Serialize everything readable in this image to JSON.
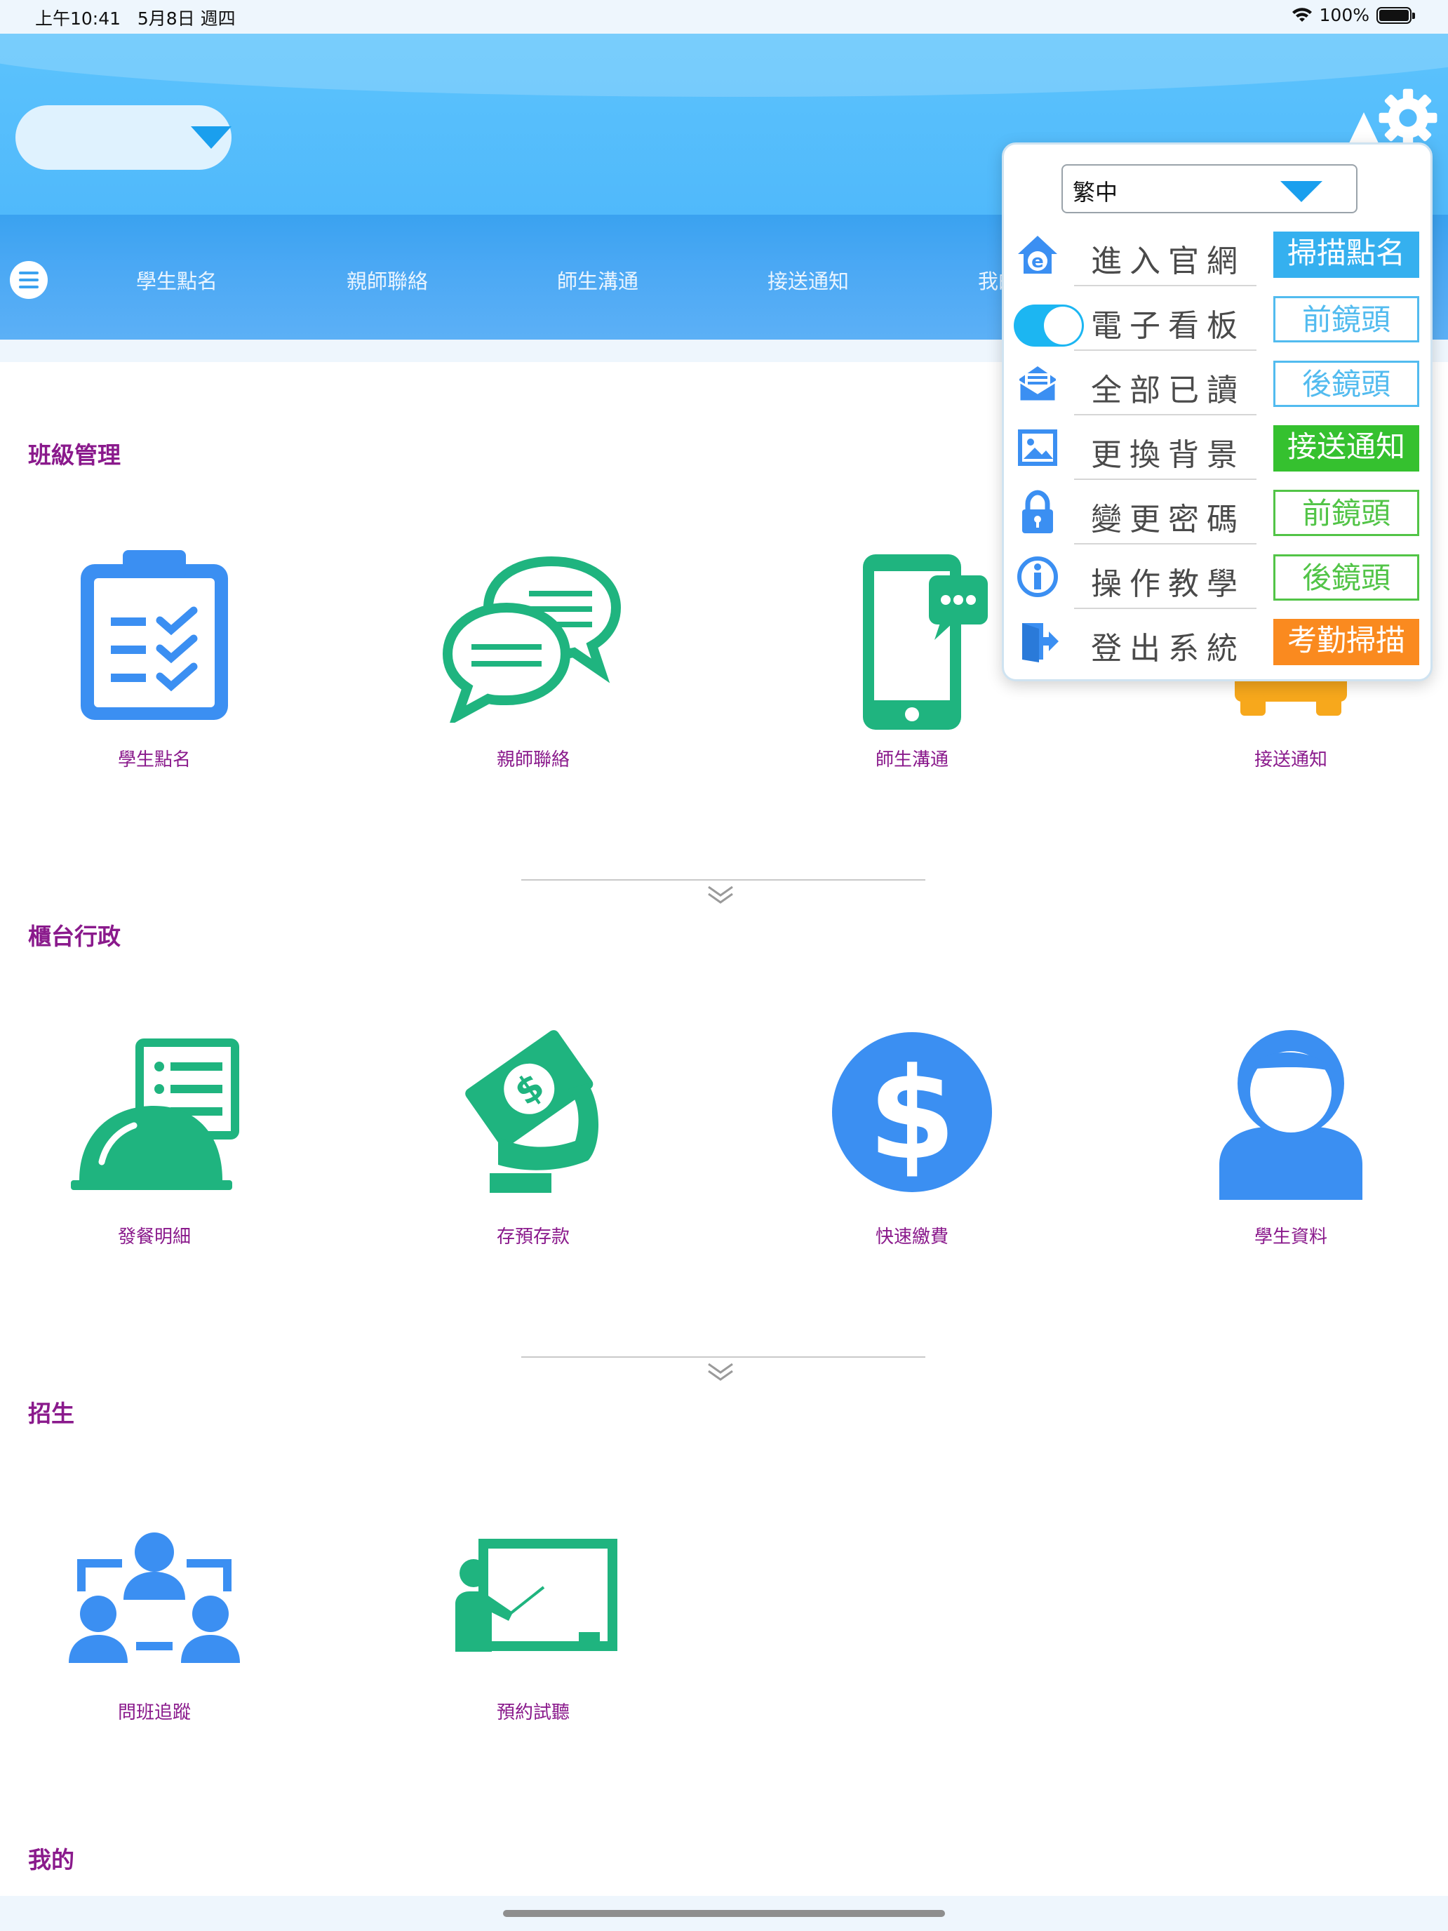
{
  "status_bar": {
    "time": "上午10:41   5月8日 週四",
    "battery": "100%"
  },
  "header": {
    "settings_icon": "gear-icon"
  },
  "nav": {
    "items": [
      "學生點名",
      "親師聯絡",
      "師生溝通",
      "接送通知",
      "我的"
    ]
  },
  "sections": [
    {
      "title": "班級管理",
      "tiles": [
        "學生點名",
        "親師聯絡",
        "師生溝通",
        "接送通知"
      ]
    },
    {
      "title": "櫃台行政",
      "tiles": [
        "發餐明細",
        "存預存款",
        "快速繳費",
        "學生資料"
      ]
    },
    {
      "title": "招生",
      "tiles": [
        "問班追蹤",
        "預約試聽"
      ]
    },
    {
      "title": "我的"
    }
  ],
  "popover": {
    "language": "繁中",
    "rows": [
      {
        "label": "進入官網",
        "icon": "home-web-icon",
        "button": "掃描點名"
      },
      {
        "label": "電子看板",
        "icon": "toggle-switch",
        "button": "前鏡頭"
      },
      {
        "label": "全部已讀",
        "icon": "envelope-read-icon",
        "button": "後鏡頭"
      },
      {
        "label": "更換背景",
        "icon": "image-icon",
        "button": "接送通知"
      },
      {
        "label": "變更密碼",
        "icon": "lock-icon",
        "button": "前鏡頭"
      },
      {
        "label": "操作教學",
        "icon": "info-icon",
        "button": "後鏡頭"
      },
      {
        "label": "登出系統",
        "icon": "logout-door-icon",
        "button": "考勤掃描"
      }
    ],
    "button_colors": {
      "blue": "#35b0ef",
      "green": "#35c12f",
      "orange": "#fa8a1f"
    }
  },
  "colors": {
    "section_title": "#8a1a8c",
    "header": "#5cc3fc",
    "nav": "#3aa2f0"
  }
}
